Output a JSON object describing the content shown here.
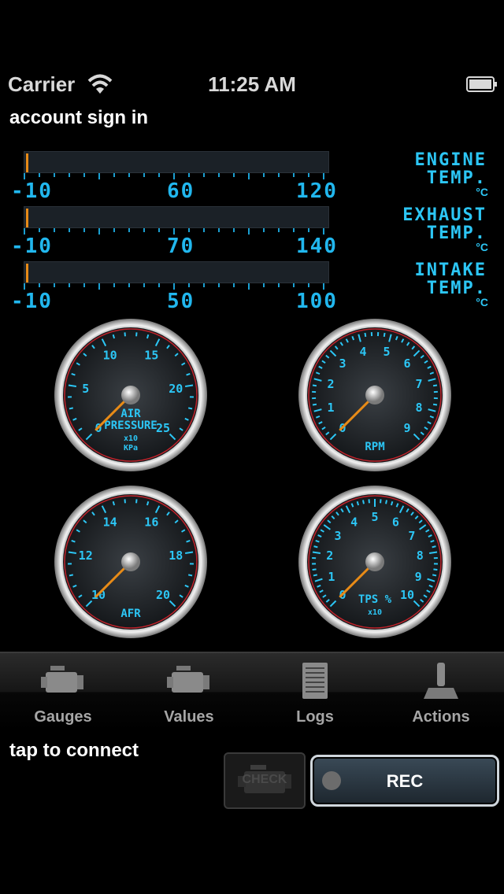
{
  "status_bar": {
    "carrier": "Carrier",
    "time": "11:25 AM"
  },
  "account_link": "account sign in",
  "temp_gauges": [
    {
      "label_line1": "ENGINE",
      "label_line2": "TEMP.",
      "unit": "°C",
      "scale": [
        "-10",
        "60",
        "120"
      ],
      "value": null
    },
    {
      "label_line1": "EXHAUST",
      "label_line2": "TEMP.",
      "unit": "°C",
      "scale": [
        "-10",
        "70",
        "140"
      ],
      "value": null
    },
    {
      "label_line1": "INTAKE",
      "label_line2": "TEMP.",
      "unit": "°C",
      "scale": [
        "-10",
        "50",
        "100"
      ],
      "value": null
    }
  ],
  "dial_gauges": [
    {
      "name": "air-pressure",
      "ticks": [
        "0",
        "5",
        "10",
        "15",
        "20",
        "25"
      ],
      "label_lines": [
        "AIR",
        "PRESSURE",
        "x10",
        "KPa"
      ]
    },
    {
      "name": "rpm",
      "ticks": [
        "0",
        "1",
        "2",
        "3",
        "4",
        "5",
        "6",
        "7",
        "8",
        "9"
      ],
      "label_lines": [
        "RPM"
      ]
    },
    {
      "name": "afr",
      "ticks": [
        "10",
        "12",
        "14",
        "16",
        "18",
        "20"
      ],
      "label_lines": [
        "AFR"
      ]
    },
    {
      "name": "tps",
      "ticks": [
        "0",
        "1",
        "2",
        "3",
        "4",
        "5",
        "6",
        "7",
        "8",
        "9",
        "10"
      ],
      "label_lines": [
        "TPS %",
        "x10"
      ]
    }
  ],
  "tabs": [
    {
      "label": "Gauges",
      "icon": "engine-icon"
    },
    {
      "label": "Values",
      "icon": "engine-icon"
    },
    {
      "label": "Logs",
      "icon": "document-icon"
    },
    {
      "label": "Actions",
      "icon": "joystick-icon"
    }
  ],
  "connect_text": "tap to connect",
  "check_button": "CHECK",
  "rec_button": "REC",
  "colors": {
    "accent": "#2cc6f5",
    "needle": "#e88b17",
    "redline": "#c0242c"
  }
}
